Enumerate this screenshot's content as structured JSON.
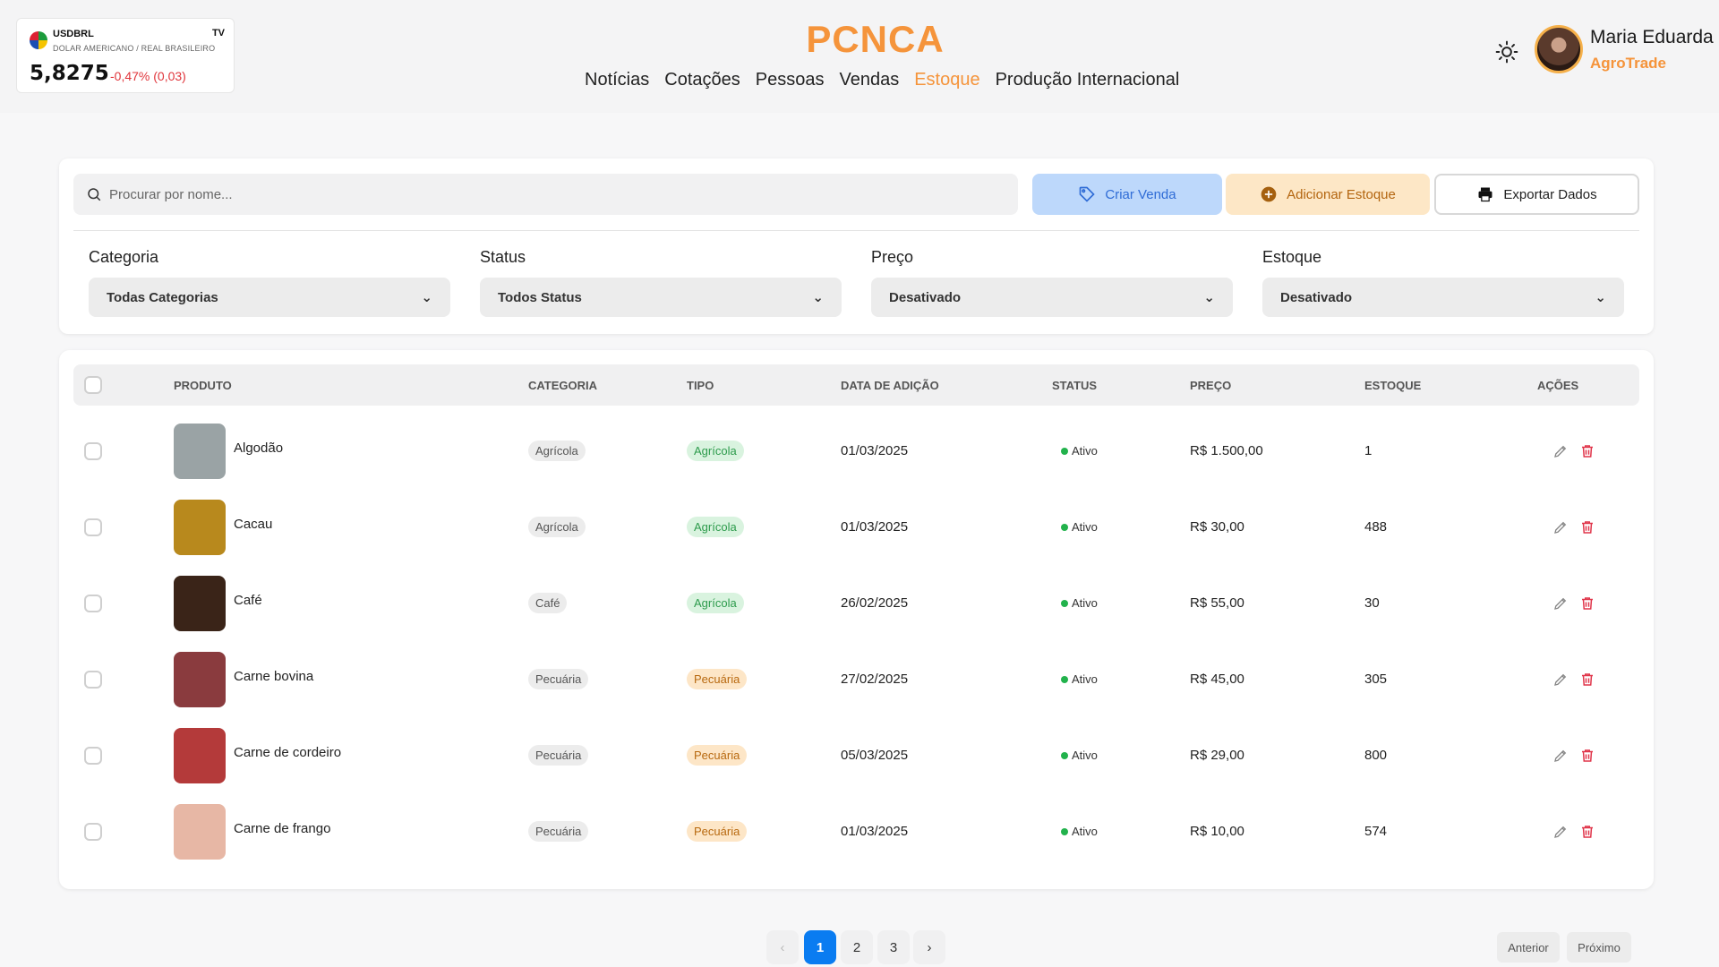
{
  "ticker": {
    "symbol": "USDBRL",
    "description": "DOLAR AMERICANO / REAL BRASILEIRO",
    "price": "5,8275",
    "change": "-0,47% (0,03)",
    "badge": "TV"
  },
  "header": {
    "brand": "PCNCA",
    "nav": [
      {
        "label": "Notícias",
        "active": false
      },
      {
        "label": "Cotações",
        "active": false
      },
      {
        "label": "Pessoas",
        "active": false
      },
      {
        "label": "Vendas",
        "active": false
      },
      {
        "label": "Estoque",
        "active": true
      },
      {
        "label": "Produção Internacional",
        "active": false
      }
    ],
    "user_name": "Maria Eduarda",
    "user_company": "AgroTrade"
  },
  "toolbar": {
    "search_placeholder": "Procurar por nome...",
    "create_sale": "Criar Venda",
    "add_stock": "Adicionar Estoque",
    "export": "Exportar Dados"
  },
  "filters": [
    {
      "label": "Categoria",
      "value": "Todas Categorias"
    },
    {
      "label": "Status",
      "value": "Todos Status"
    },
    {
      "label": "Preço",
      "value": "Desativado"
    },
    {
      "label": "Estoque",
      "value": "Desativado"
    }
  ],
  "table": {
    "headers": {
      "product": "PRODUTO",
      "category": "CATEGORIA",
      "type": "TIPO",
      "date": "DATA DE ADIÇÃO",
      "status": "STATUS",
      "price": "PREÇO",
      "stock": "ESTOQUE",
      "actions": "AÇÕES"
    },
    "rows": [
      {
        "name": "Algodão",
        "category": "Agrícola",
        "type": "Agrícola",
        "type_color": "green",
        "date": "01/03/2025",
        "status": "Ativo",
        "price": "R$ 1.500,00",
        "stock": "1",
        "thumb": "#9aa3a5"
      },
      {
        "name": "Cacau",
        "category": "Agrícola",
        "type": "Agrícola",
        "type_color": "green",
        "date": "01/03/2025",
        "status": "Ativo",
        "price": "R$ 30,00",
        "stock": "488",
        "thumb": "#b8891d"
      },
      {
        "name": "Café",
        "category": "Café",
        "type": "Agrícola",
        "type_color": "green",
        "date": "26/02/2025",
        "status": "Ativo",
        "price": "R$ 55,00",
        "stock": "30",
        "thumb": "#3a2418"
      },
      {
        "name": "Carne bovina",
        "category": "Pecuária",
        "type": "Pecuária",
        "type_color": "orange",
        "date": "27/02/2025",
        "status": "Ativo",
        "price": "R$ 45,00",
        "stock": "305",
        "thumb": "#8a3b3e"
      },
      {
        "name": "Carne de cordeiro",
        "category": "Pecuária",
        "type": "Pecuária",
        "type_color": "orange",
        "date": "05/03/2025",
        "status": "Ativo",
        "price": "R$ 29,00",
        "stock": "800",
        "thumb": "#b43a3a"
      },
      {
        "name": "Carne de frango",
        "category": "Pecuária",
        "type": "Pecuária",
        "type_color": "orange",
        "date": "01/03/2025",
        "status": "Ativo",
        "price": "R$ 10,00",
        "stock": "574",
        "thumb": "#e7b7a5"
      }
    ]
  },
  "pagination": {
    "pages": [
      "1",
      "2",
      "3"
    ],
    "current": "1",
    "prev_label": "Anterior",
    "next_label": "Próximo"
  },
  "colors": {
    "accent": "#f5943b",
    "primary_blue": "#0a7cf1",
    "status_active": "#22b24c",
    "delete": "#e0354a"
  }
}
